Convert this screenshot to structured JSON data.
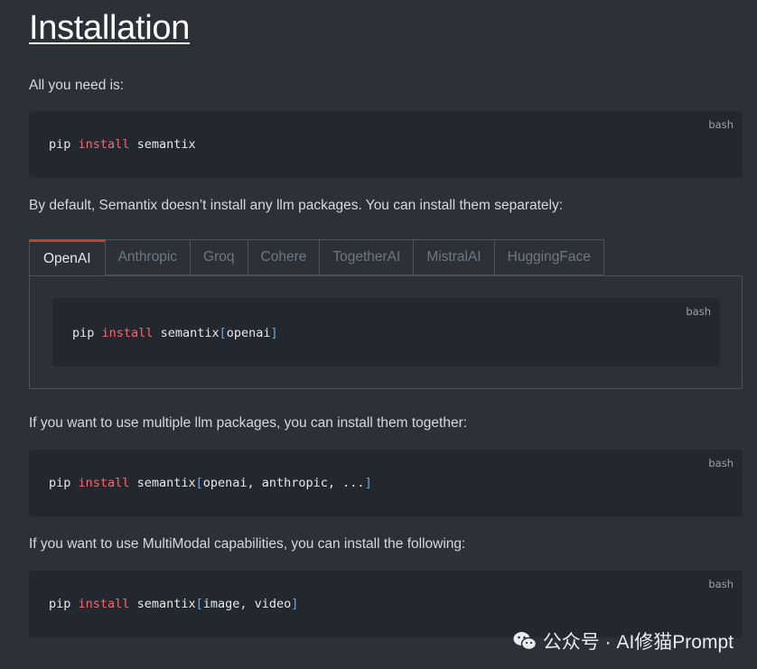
{
  "heading": "Installation",
  "intro": "All you need is:",
  "code_lang": "bash",
  "code1": {
    "cmd": "pip",
    "kw": "install",
    "pkg": "semantix",
    "bracket": ""
  },
  "para_default": "By default, Semantix doesn’t install any llm packages. You can install them separately:",
  "tabs": [
    {
      "label": "OpenAI",
      "active": true
    },
    {
      "label": "Anthropic",
      "active": false
    },
    {
      "label": "Groq",
      "active": false
    },
    {
      "label": "Cohere",
      "active": false
    },
    {
      "label": "TogetherAI",
      "active": false
    },
    {
      "label": "MistralAI",
      "active": false
    },
    {
      "label": "HuggingFace",
      "active": false
    }
  ],
  "tab_code": {
    "cmd": "pip",
    "kw": "install",
    "pkg": "semantix",
    "open": "[",
    "args": "openai",
    "close": "]"
  },
  "para_multiple": "If you want to use multiple llm packages, you can install them together:",
  "code_multi": {
    "cmd": "pip",
    "kw": "install",
    "pkg": "semantix",
    "open": "[",
    "args": "openai, anthropic, ...",
    "close": "]"
  },
  "para_multimodal": "If you want to use MultiModal capabilities, you can install the following:",
  "code_mm": {
    "cmd": "pip",
    "kw": "install",
    "pkg": "semantix",
    "open": "[",
    "args": "image, video",
    "close": "]"
  },
  "watermark": "公众号 · AI修猫Prompt"
}
